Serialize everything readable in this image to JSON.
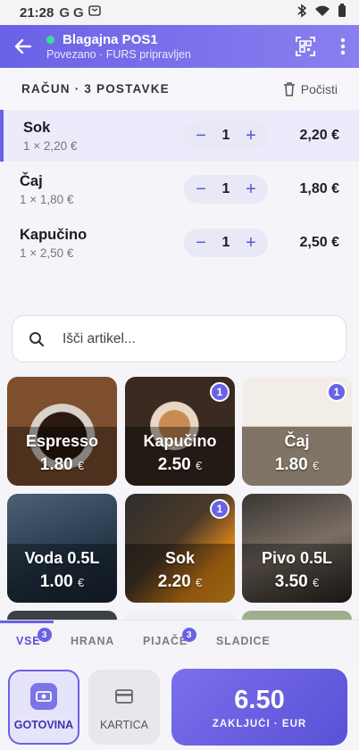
{
  "status_bar": {
    "time": "21:28",
    "g1": "G",
    "g2": "G"
  },
  "app_bar": {
    "title": "Blagajna POS1",
    "subtitle": "Povezano · FURS pripravljen",
    "online_color": "#3ddc97"
  },
  "receipt": {
    "header": "RAČUN · 3 POSTAVKE",
    "clear_label": "Počisti",
    "items": [
      {
        "name": "Sok",
        "detail": "1 × 2,20 €",
        "qty": "1",
        "total": "2,20 €"
      },
      {
        "name": "Čaj",
        "detail": "1 × 1,80 €",
        "qty": "1",
        "total": "1,80 €"
      },
      {
        "name": "Kapučino",
        "detail": "1 × 2,50 €",
        "qty": "1",
        "total": "2,50 €"
      }
    ]
  },
  "search": {
    "placeholder": "Išči artikel..."
  },
  "products": [
    {
      "name": "Espresso",
      "price": "1.80",
      "currency": "€"
    },
    {
      "name": "Kapučino",
      "price": "2.50",
      "currency": "€",
      "badge": "1"
    },
    {
      "name": "Čaj",
      "price": "1.80",
      "currency": "€",
      "badge": "1"
    },
    {
      "name": "Voda 0.5L",
      "price": "1.00",
      "currency": "€"
    },
    {
      "name": "Sok",
      "price": "2.20",
      "currency": "€",
      "badge": "1"
    },
    {
      "name": "Pivo 0.5L",
      "price": "3.50",
      "currency": "€"
    }
  ],
  "categories": [
    {
      "label": "VSE",
      "badge": "3"
    },
    {
      "label": "HRANA"
    },
    {
      "label": "PIJAČE",
      "badge": "3"
    },
    {
      "label": "SLADICE"
    }
  ],
  "payment": {
    "cash_label": "GOTOVINA",
    "card_label": "KARTICA",
    "total": "6.50",
    "finish_label": "ZAKLJUČI · EUR"
  },
  "colors": {
    "accent": "#6a62e6",
    "accent_dark": "#5a52d8"
  }
}
